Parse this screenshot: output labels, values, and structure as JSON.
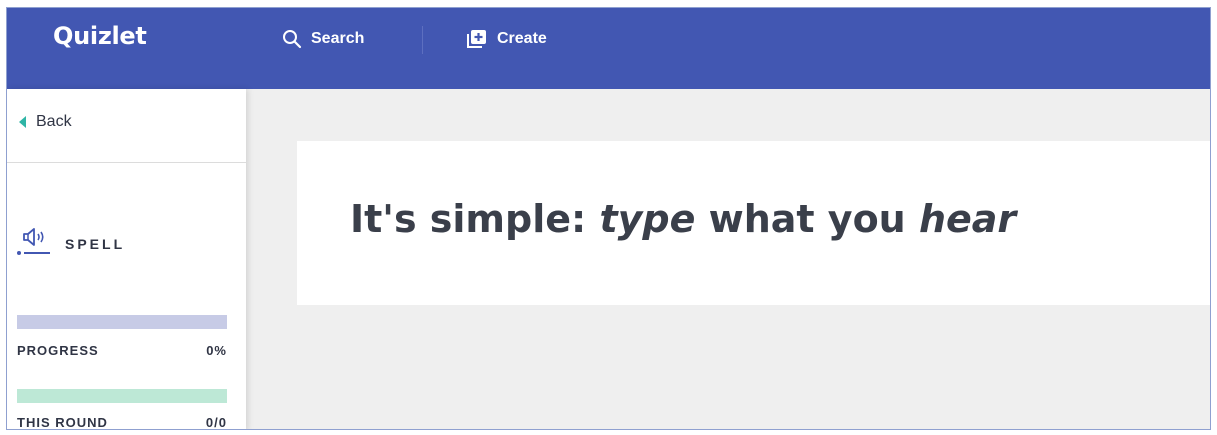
{
  "header": {
    "logo": "Quizlet",
    "search_label": "Search",
    "create_label": "Create",
    "icons": [
      "search-icon",
      "create-plus-icon"
    ],
    "background_color": "#4257b2"
  },
  "sidebar": {
    "back_label": "Back",
    "mode_label": "SPELL",
    "mode_icon": "speaker-icon",
    "progress": {
      "label": "PROGRESS",
      "value": "0%",
      "fraction": 0
    },
    "this_round": {
      "label": "THIS ROUND",
      "value": "0/0",
      "fraction": 0
    }
  },
  "main": {
    "prompt_parts": [
      "It's simple: ",
      "type",
      " what you ",
      "hear"
    ]
  }
}
